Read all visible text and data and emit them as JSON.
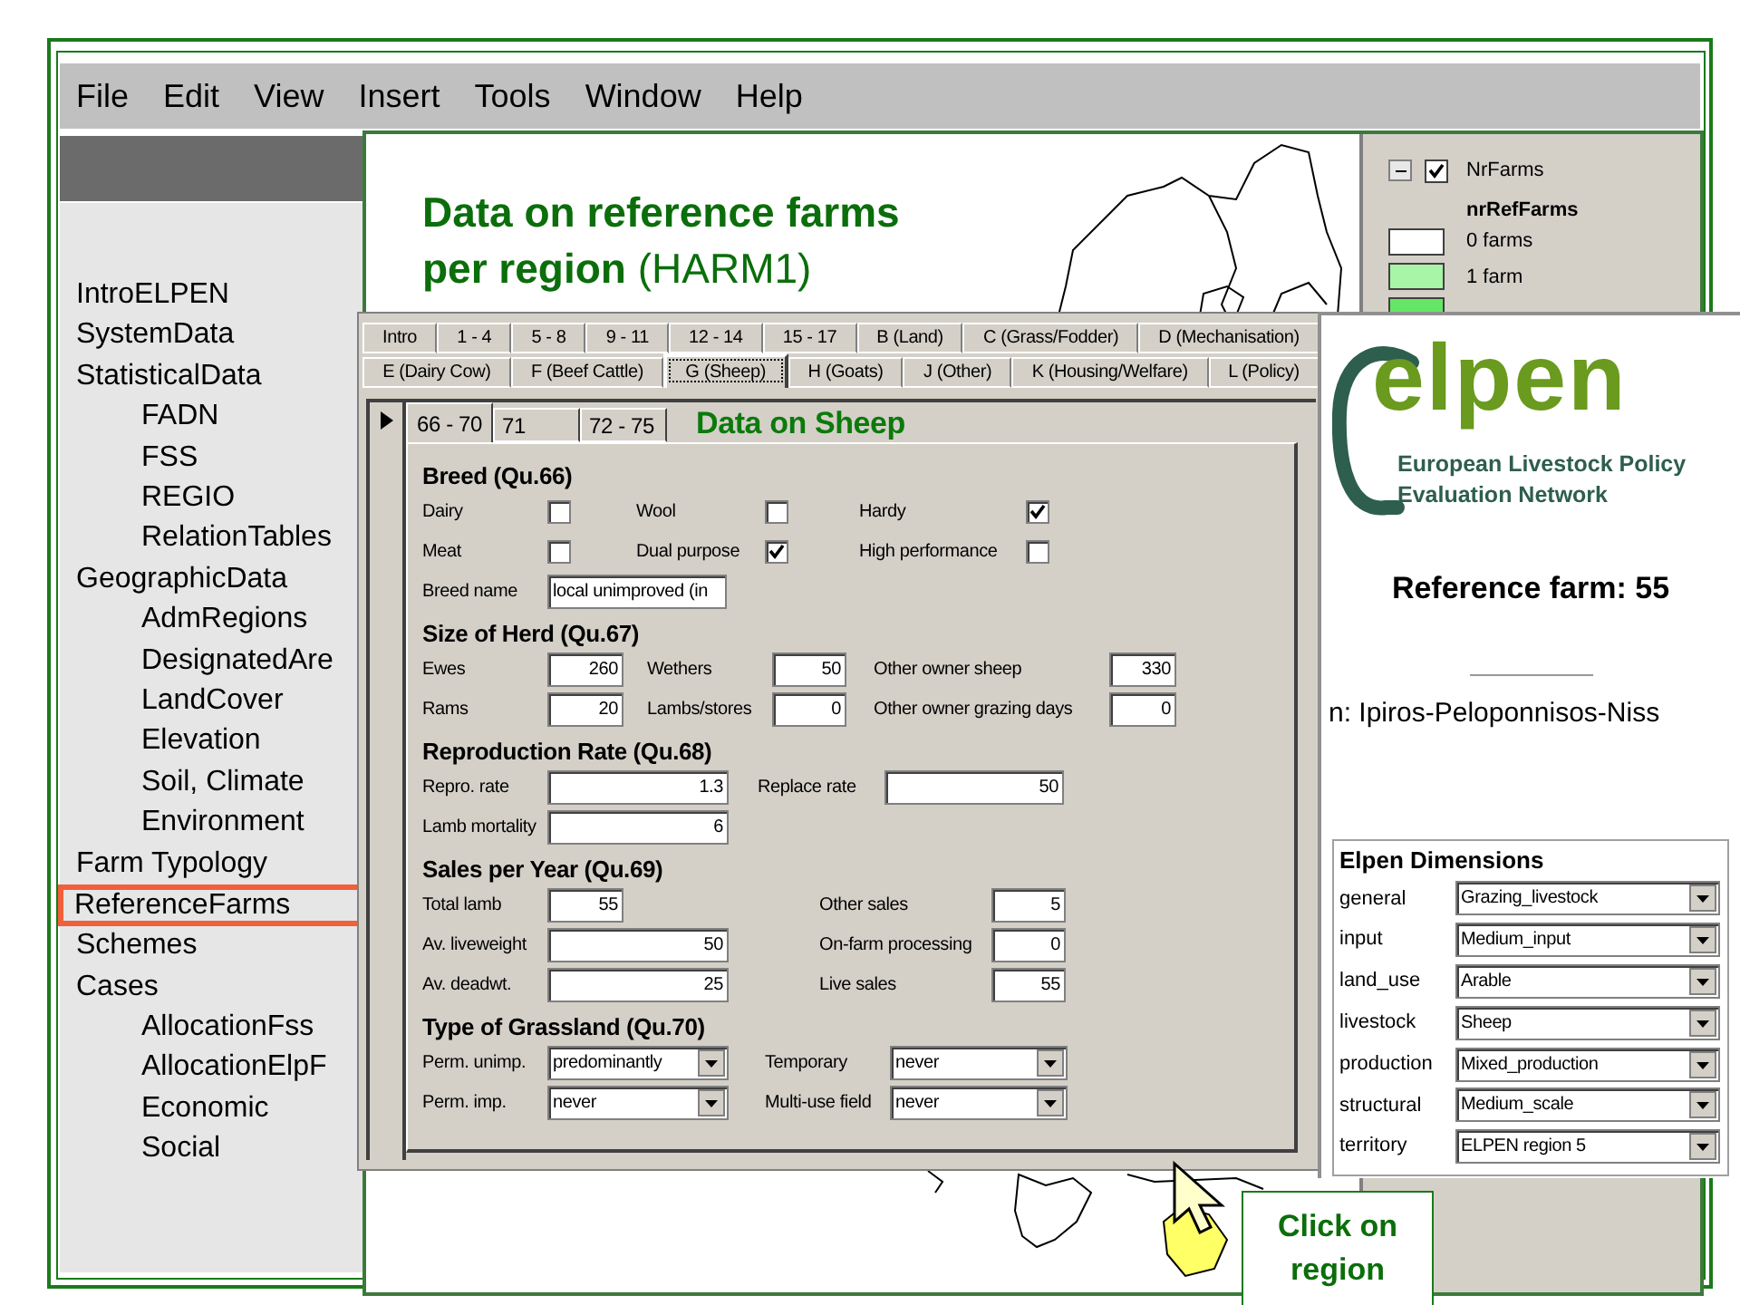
{
  "menu": [
    "File",
    "Edit",
    "View",
    "Insert",
    "Tools",
    "Window",
    "Help"
  ],
  "sidebar": {
    "items": [
      {
        "label": "IntroELPEN",
        "selected": false
      },
      {
        "label": "SystemData",
        "selected": false
      },
      {
        "label": "StatisticalData",
        "selected": false,
        "children": [
          {
            "label": "FADN",
            "selected": false
          },
          {
            "label": "FSS",
            "selected": false
          },
          {
            "label": "REGIO",
            "selected": false
          },
          {
            "label": "RelationTables",
            "selected": false
          }
        ]
      },
      {
        "label": "GeographicData",
        "selected": false,
        "children": [
          {
            "label": "AdmRegions",
            "selected": false
          },
          {
            "label": "DesignatedAre",
            "selected": false
          },
          {
            "label": "LandCover",
            "selected": false
          },
          {
            "label": "Elevation",
            "selected": false
          },
          {
            "label": "Soil, Climate",
            "selected": false
          },
          {
            "label": "Environment",
            "selected": false
          }
        ]
      },
      {
        "label": "Farm Typology",
        "selected": false
      },
      {
        "label": "ReferenceFarms",
        "selected": true
      },
      {
        "label": "Schemes",
        "selected": false
      },
      {
        "label": "Cases",
        "selected": false,
        "children": [
          {
            "label": "AllocationFss",
            "selected": false
          },
          {
            "label": "AllocationElpF",
            "selected": false
          },
          {
            "label": "Economic",
            "selected": false
          },
          {
            "label": "Social",
            "selected": false
          }
        ]
      }
    ]
  },
  "map_window": {
    "title": "**Data on reference farms per region** (HARM1)",
    "legend": {
      "expanded": true,
      "layer": "NrFarms",
      "visible": true,
      "field": "nrRefFarms",
      "classes": [
        {
          "label": "0 farms",
          "color": "#ffffff"
        },
        {
          "label": "1 farm",
          "color": "#a8f5a8"
        },
        {
          "color": "#66e666"
        }
      ]
    }
  },
  "form": {
    "tab_rows": [
      {
        "tabs": [
          {
            "label": "Intro",
            "selected": false
          },
          {
            "label": "1 - 4",
            "selected": false
          },
          {
            "label": "5 - 8",
            "selected": false
          },
          {
            "label": "9 - 11",
            "selected": false
          },
          {
            "label": "12 - 14",
            "selected": false
          },
          {
            "label": "15 - 17",
            "selected": false
          },
          {
            "label": "B (Land)",
            "selected": false
          },
          {
            "label": "C (Grass/Fodder)",
            "selected": false
          },
          {
            "label": "D (Mechanisation)",
            "selected": false
          }
        ]
      },
      {
        "tabs": [
          {
            "label": "E (Dairy Cow)",
            "selected": false
          },
          {
            "label": "F (Beef Cattle)",
            "selected": false
          },
          {
            "label": "G (Sheep)",
            "selected": true
          },
          {
            "label": "H (Goats)",
            "selected": false
          },
          {
            "label": "J (Other)",
            "selected": false
          },
          {
            "label": "K (Housing/Welfare)",
            "selected": false
          },
          {
            "label": "L (Policy)",
            "selected": false
          }
        ]
      }
    ],
    "subtabs": [
      {
        "label": "66 - 70",
        "selected": true
      },
      {
        "label": "71",
        "selected": false
      },
      {
        "label": "72 - 75",
        "selected": false
      }
    ],
    "title": "Data on Sheep",
    "sections": [
      {
        "heading": "Breed (Qu.66)",
        "rows": [
          [
            {
              "kind": "checkbox",
              "label": "Dairy",
              "checked": false
            },
            {
              "kind": "checkbox",
              "label": "Wool",
              "checked": false
            },
            {
              "kind": "checkbox",
              "label": "Hardy",
              "checked": true
            }
          ],
          [
            {
              "kind": "checkbox",
              "label": "Meat",
              "checked": false
            },
            {
              "kind": "checkbox",
              "label": "Dual purpose",
              "checked": true
            },
            {
              "kind": "checkbox",
              "label": "High performance",
              "checked": false
            }
          ],
          [
            {
              "kind": "text",
              "label": "Breed name",
              "value": "local unimproved (in"
            }
          ]
        ]
      },
      {
        "heading": "Size of Herd (Qu.67)",
        "rows": [
          [
            {
              "kind": "number",
              "label": "Ewes",
              "value": "260"
            },
            {
              "kind": "number",
              "label": "Wethers",
              "value": "50"
            },
            {
              "kind": "number",
              "label": "Other owner sheep",
              "value": "330"
            }
          ],
          [
            {
              "kind": "number",
              "label": "Rams",
              "value": "20"
            },
            {
              "kind": "number",
              "label": "Lambs/stores",
              "value": "0"
            },
            {
              "kind": "number",
              "label": "Other owner grazing days",
              "value": "0"
            }
          ]
        ]
      },
      {
        "heading": "Reproduction Rate (Qu.68)",
        "rows": [
          [
            {
              "kind": "number",
              "label": "Repro. rate",
              "value": "1.3"
            },
            {
              "kind": "number",
              "label": "Replace rate",
              "value": "50"
            }
          ],
          [
            {
              "kind": "number",
              "label": "Lamb mortality",
              "value": "6"
            }
          ]
        ]
      },
      {
        "heading": "Sales per Year (Qu.69)",
        "rows": [
          [
            {
              "kind": "number",
              "label": "Total lamb",
              "value": "55"
            },
            {
              "kind": "number",
              "label": "Other sales",
              "value": "5"
            }
          ],
          [
            {
              "kind": "number",
              "label": "Av. liveweight",
              "value": "50"
            },
            {
              "kind": "number",
              "label": "On-farm processing",
              "value": "0"
            }
          ],
          [
            {
              "kind": "number",
              "label": "Av. deadwt.",
              "value": "25"
            },
            {
              "kind": "number",
              "label": "Live sales",
              "value": "55"
            }
          ]
        ]
      },
      {
        "heading": "Type of Grassland (Qu.70)",
        "rows": [
          [
            {
              "kind": "dropdown",
              "label": "Perm. unimp.",
              "value": "predominantly"
            },
            {
              "kind": "dropdown",
              "label": "Temporary",
              "value": "never"
            }
          ],
          [
            {
              "kind": "dropdown",
              "label": "Perm. imp.",
              "value": "never"
            },
            {
              "kind": "dropdown",
              "label": "Multi-use field",
              "value": "never"
            }
          ]
        ]
      }
    ]
  },
  "elpen": {
    "logo_text": "elpen",
    "tagline": [
      "European Livestock Policy",
      "Evaluation Network"
    ],
    "reference": "Reference farm: 55",
    "region": "n: Ipiros-Peloponnisos-Niss",
    "dimensions": {
      "title": "Elpen Dimensions",
      "rows": [
        {
          "label": "general",
          "value": "Grazing_livestock"
        },
        {
          "label": "input",
          "value": "Medium_input"
        },
        {
          "label": "land_use",
          "value": "Arable"
        },
        {
          "label": "livestock",
          "value": "Sheep"
        },
        {
          "label": "production",
          "value": "Mixed_production"
        },
        {
          "label": "structural",
          "value": "Medium_scale"
        },
        {
          "label": "territory",
          "value": "ELPEN region 5"
        }
      ]
    }
  },
  "callout": "Click on region"
}
